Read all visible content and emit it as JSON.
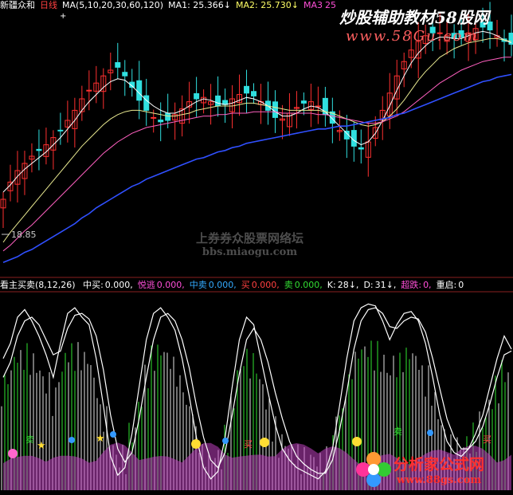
{
  "top_bar": {
    "stock_name": "新疆众和",
    "period": "日线",
    "ma_label": "MA(5,10,20,30,60,120)",
    "ma1": "MA1: 25.366↓",
    "ma2": "MA2: 25.730↓",
    "ma3": "MA3",
    "ma3_value": "25"
  },
  "indicator_bar": {
    "title": "看主买卖(8,12,26)",
    "items": [
      {
        "label": "中买:",
        "value": "0.000,",
        "color": "#ffffff"
      },
      {
        "label": "悦逃",
        "value": "0.000,",
        "color": "#ff4fd8"
      },
      {
        "label": "中卖",
        "value": "0.000,",
        "color": "#33aaff"
      },
      {
        "label": "买",
        "value": "0.000,",
        "color": "#ff4040"
      },
      {
        "label": "卖",
        "value": "0.000,",
        "color": "#33dd33"
      },
      {
        "label": "K:",
        "value": "28↓,",
        "color": "#ffffff"
      },
      {
        "label": "D:",
        "value": "31↓,",
        "color": "#ffffff"
      },
      {
        "label": "超跌:",
        "value": "0,",
        "color": "#ff4fd8"
      },
      {
        "label": "重启:",
        "value": "0",
        "color": "#ffffff"
      }
    ]
  },
  "price_label": "18.85",
  "watermarks": {
    "top_title": "炒股辅助教材58股网",
    "top_url": "www.58Gu.com",
    "center_title": "上券券众股票网络坛",
    "center_url": "bbs.miaogu.com",
    "bottom_brand": "分析家公式网",
    "bottom_url": "www.88gs.com"
  },
  "markers": {
    "sell": "卖",
    "buy": "买"
  },
  "colors": {
    "up": "#ff3030",
    "down": "#30e0e0",
    "ma_white": "#ffffff",
    "ma_yellow": "#e8e890",
    "ma_pink": "#ff60c0",
    "ma_green": "#70d070",
    "ma_blue": "#3050ff",
    "hist_green": "#30e030",
    "hist_white": "#e0e0e0",
    "hist_magenta": "#c040c0"
  },
  "chart_data": [
    {
      "type": "candlestick",
      "panel": "main",
      "series": [
        {
          "name": "close",
          "values": [
            20.0,
            21.2,
            22.0,
            22.5,
            23.0,
            23.4,
            23.8,
            24.3,
            24.8,
            25.5,
            26.2,
            27.0,
            27.6,
            28.1,
            28.6,
            29.0,
            29.2,
            28.6,
            27.8,
            26.9,
            26.2,
            25.7,
            25.4,
            25.5,
            25.9,
            26.3,
            26.8,
            27.0,
            27.1,
            26.8,
            26.5,
            26.6,
            27.0,
            27.3,
            27.4,
            27.2,
            26.8,
            26.2,
            25.7,
            25.6,
            26.0,
            26.4,
            26.7,
            26.8,
            26.5,
            25.9,
            25.3,
            24.8,
            24.2,
            23.7,
            23.5,
            24.0,
            25.0,
            26.2,
            27.4,
            28.6,
            29.6,
            30.4,
            31.0,
            31.4,
            31.6,
            31.6,
            31.4,
            31.2,
            31.3,
            31.6,
            31.9,
            32.0,
            31.8,
            31.4,
            31.0,
            30.8
          ]
        },
        {
          "name": "MA1",
          "values": [
            20.5,
            21.0,
            21.6,
            22.1,
            22.5,
            22.9,
            23.3,
            23.8,
            24.3,
            24.9,
            25.5,
            26.2,
            26.8,
            27.3,
            27.8,
            28.2,
            28.4,
            28.3,
            27.9,
            27.4,
            26.9,
            26.5,
            26.2,
            26.0,
            26.0,
            26.2,
            26.5,
            26.8,
            27.0,
            26.9,
            26.7,
            26.6,
            26.7,
            26.9,
            27.1,
            27.0,
            26.8,
            26.5,
            26.1,
            25.8,
            25.8,
            26.0,
            26.3,
            26.5,
            26.4,
            26.1,
            25.6,
            25.1,
            24.6,
            24.1,
            23.8,
            24.0,
            24.6,
            25.5,
            26.5,
            27.6,
            28.6,
            29.5,
            30.2,
            30.7,
            31.1,
            31.3,
            31.3,
            31.2,
            31.2,
            31.4,
            31.6,
            31.7,
            31.6,
            31.4,
            31.1,
            30.9
          ]
        },
        {
          "name": "MA2",
          "values": [
            17.0,
            17.7,
            18.3,
            18.9,
            19.5,
            20.1,
            20.7,
            21.3,
            21.9,
            22.5,
            23.1,
            23.7,
            24.2,
            24.7,
            25.2,
            25.6,
            25.9,
            26.1,
            26.2,
            26.2,
            26.1,
            26.0,
            25.9,
            25.8,
            25.8,
            25.9,
            26.0,
            26.2,
            26.3,
            26.4,
            26.5,
            26.5,
            26.5,
            26.6,
            26.7,
            26.7,
            26.6,
            26.5,
            26.4,
            26.3,
            26.2,
            26.2,
            26.2,
            26.2,
            26.2,
            26.1,
            26.0,
            25.8,
            25.6,
            25.4,
            25.2,
            25.1,
            25.2,
            25.4,
            25.8,
            26.3,
            26.9,
            27.6,
            28.3,
            28.9,
            29.4,
            29.9,
            30.2,
            30.5,
            30.7,
            30.9,
            31.0,
            31.1,
            31.2,
            31.2,
            31.1,
            31.0
          ]
        },
        {
          "name": "MA3",
          "values": [
            16.4,
            16.8,
            17.3,
            17.8,
            18.2,
            18.7,
            19.2,
            19.7,
            20.2,
            20.7,
            21.2,
            21.7,
            22.2,
            22.7,
            23.2,
            23.6,
            24.0,
            24.3,
            24.6,
            24.8,
            25.0,
            25.1,
            25.2,
            25.3,
            25.4,
            25.5,
            25.6,
            25.7,
            25.8,
            25.8,
            25.9,
            25.9,
            26.0,
            26.0,
            26.0,
            26.1,
            26.1,
            26.1,
            26.1,
            26.0,
            26.0,
            26.0,
            26.0,
            26.0,
            25.9,
            25.9,
            25.8,
            25.7,
            25.6,
            25.5,
            25.4,
            25.3,
            25.3,
            25.4,
            25.6,
            25.8,
            26.1,
            26.5,
            26.9,
            27.3,
            27.7,
            28.1,
            28.4,
            28.7,
            29.0,
            29.2,
            29.4,
            29.6,
            29.7,
            29.8,
            29.9,
            29.9
          ]
        },
        {
          "name": "MA6",
          "values": [
            15.6,
            15.8,
            16.0,
            16.3,
            16.5,
            16.8,
            17.1,
            17.4,
            17.7,
            18.0,
            18.3,
            18.7,
            19.0,
            19.4,
            19.7,
            20.0,
            20.3,
            20.6,
            20.9,
            21.1,
            21.4,
            21.6,
            21.8,
            22.0,
            22.2,
            22.4,
            22.6,
            22.8,
            22.9,
            23.1,
            23.3,
            23.4,
            23.6,
            23.7,
            23.9,
            24.0,
            24.1,
            24.2,
            24.3,
            24.4,
            24.5,
            24.6,
            24.7,
            24.8,
            24.9,
            24.9,
            25.0,
            25.1,
            25.1,
            25.2,
            25.3,
            25.4,
            25.5,
            25.6,
            25.7,
            25.9,
            26.0,
            26.2,
            26.4,
            26.6,
            26.8,
            27.0,
            27.2,
            27.4,
            27.6,
            27.8,
            28.0,
            28.2,
            28.3,
            28.5,
            28.6,
            28.7
          ]
        }
      ],
      "ylim": [
        15.0,
        33.0
      ]
    },
    {
      "type": "line",
      "panel": "indicator",
      "series": [
        {
          "name": "K",
          "values": [
            70,
            78,
            92,
            96,
            90,
            82,
            72,
            60,
            78,
            94,
            97,
            92,
            88,
            70,
            45,
            18,
            8,
            12,
            30,
            55,
            80,
            94,
            97,
            92,
            85,
            70,
            50,
            28,
            12,
            6,
            10,
            28,
            55,
            80,
            92,
            88,
            70,
            52,
            35,
            22,
            16,
            12,
            10,
            8,
            6,
            10,
            22,
            45,
            70,
            90,
            97,
            99,
            98,
            90,
            80,
            88,
            94,
            95,
            90,
            78,
            60,
            40,
            26,
            20,
            18,
            22,
            30,
            40,
            55,
            70,
            82,
            75
          ]
        },
        {
          "name": "D",
          "values": [
            60,
            68,
            82,
            90,
            92,
            88,
            80,
            72,
            74,
            86,
            93,
            94,
            91,
            82,
            64,
            40,
            22,
            15,
            20,
            38,
            60,
            80,
            92,
            94,
            90,
            80,
            65,
            45,
            28,
            16,
            12,
            20,
            40,
            62,
            80,
            86,
            80,
            68,
            52,
            38,
            26,
            18,
            14,
            11,
            9,
            9,
            16,
            32,
            52,
            75,
            90,
            96,
            97,
            94,
            87,
            86,
            90,
            92,
            91,
            84,
            70,
            54,
            38,
            28,
            22,
            22,
            26,
            34,
            46,
            60,
            72,
            74
          ]
        }
      ],
      "ylim": [
        0,
        100
      ]
    }
  ]
}
